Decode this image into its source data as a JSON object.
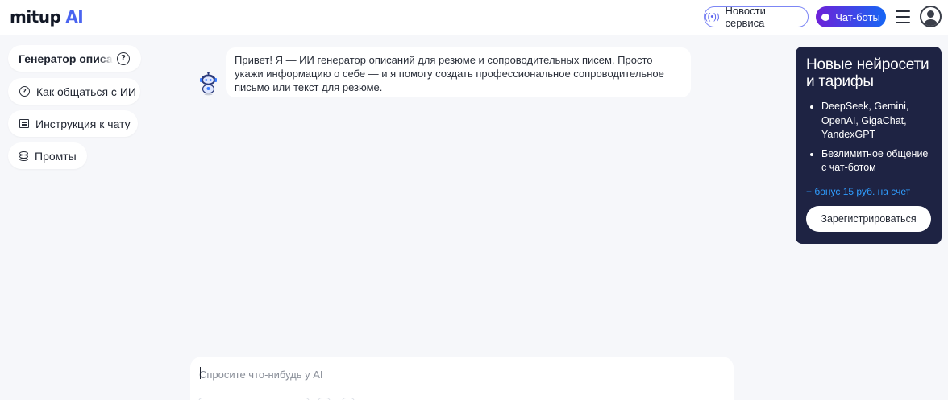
{
  "header": {
    "logo_text": "mitup",
    "logo_accent": "AI",
    "news_button": "Новости сервиса",
    "chatbots_button": "Чат-боты"
  },
  "sidebar": {
    "items": [
      {
        "label": "Генератор описаний для резюме",
        "icon": "help-circle-icon"
      },
      {
        "label": "Как общаться с ИИ",
        "icon": "help-circle-icon"
      },
      {
        "label": "Инструкция к чату",
        "icon": "document-icon"
      },
      {
        "label": "Промты",
        "icon": "database-icon"
      }
    ]
  },
  "chat": {
    "bot_message": "Привет! Я — ИИ генератор описаний для резюме и сопроводительных писем. Просто укажи информацию о себе — и я помогу создать профессиональное сопроводительное письмо или текст для резюме."
  },
  "promo": {
    "title": "Новые нейросети и тарифы",
    "bullets": [
      "DeepSeek, Gemini, OpenAI, GigaChat, YandexGPT",
      "Безлимитное общение с чат-ботом"
    ],
    "bonus": "+ бонус 15 руб. на счет",
    "register_button": "Зарегистрироваться"
  },
  "input": {
    "placeholder": "Спросите что-нибудь у AI",
    "value": ""
  },
  "colors": {
    "accent": "#4a64f0",
    "promo_bg": "#1e2343",
    "bonus": "#2f9dff",
    "gradient_start": "#6e21d8",
    "gradient_end": "#1666f4"
  }
}
